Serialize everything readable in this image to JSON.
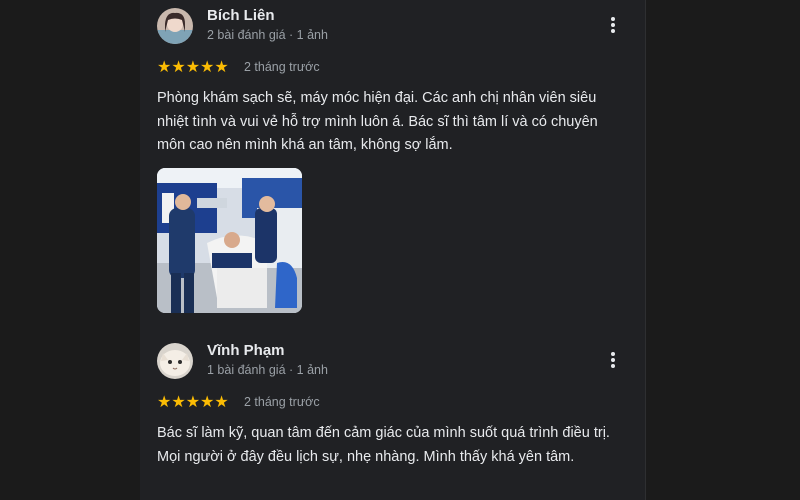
{
  "reviews": [
    {
      "name": "Bích Liên",
      "meta": "2 bài đánh giá · 1 ảnh",
      "stars": "★★★★★",
      "rating": 5,
      "date": "2 tháng trước",
      "text": "Phòng khám sạch sẽ, máy móc hiện đại. Các anh chị nhân viên siêu nhiệt tình và vui vẻ hỗ trợ mình luôn á. Bác sĩ thì tâm lí và có chuyên môn cao nên mình khá an tâm, không sợ lắm.",
      "photo_icon": "review-photo"
    },
    {
      "name": "Vĩnh Phạm",
      "meta": "1 bài đánh giá · 1 ảnh",
      "stars": "★★★★★",
      "rating": 5,
      "date": "2 tháng trước",
      "text": "Bác sĩ làm kỹ, quan tâm đến cảm giác của mình suốt quá trình điều trị. Mọi người ở đây đều lịch sự, nhẹ nhàng. Mình thấy khá yên tâm."
    }
  ],
  "colors": {
    "background": "#202124",
    "star": "#fbbc04",
    "text": "#e8eaed",
    "muted": "#9aa0a6"
  }
}
